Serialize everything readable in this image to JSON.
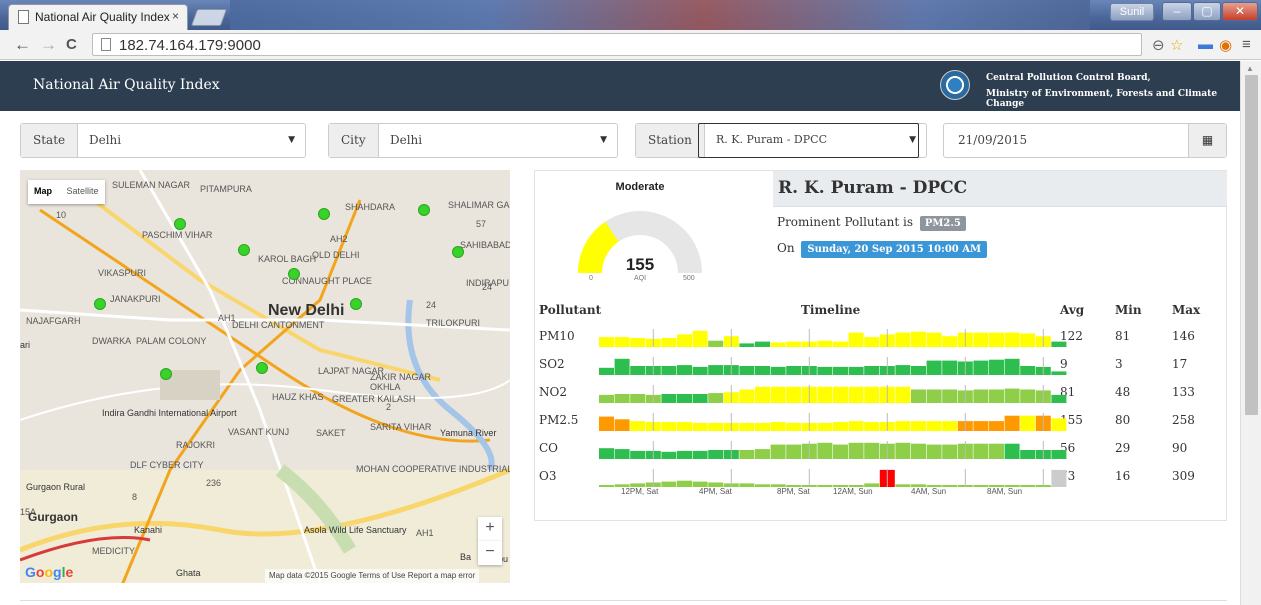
{
  "browser": {
    "tab_title": "National Air Quality Index",
    "tab_close": "×",
    "user": "Sunil",
    "url": "182.74.164.179:9000"
  },
  "header": {
    "title": "National Air Quality Index",
    "org_line1": "Central Pollution Control Board,",
    "org_line2": "Ministry of Environment, Forests and Climate Change"
  },
  "filters": {
    "state_label": "State",
    "state_value": "Delhi",
    "city_label": "City",
    "city_value": "Delhi",
    "station_label": "Station",
    "station_value": "R. K. Puram - DPCC",
    "date_value": "21/09/2015"
  },
  "map": {
    "type_map": "Map",
    "type_satellite": "Satellite",
    "labels": [
      {
        "text": "SULEMAN NAGAR",
        "cls": ""
      },
      {
        "text": "PITAMPURA",
        "cls": ""
      },
      {
        "text": "SHAHDARA",
        "cls": ""
      },
      {
        "text": "SHALIMAR GARDEN",
        "cls": ""
      },
      {
        "text": "PASCHIM VIHAR",
        "cls": ""
      },
      {
        "text": "SAHIBABAD",
        "cls": ""
      },
      {
        "text": "KAROL BAGH",
        "cls": ""
      },
      {
        "text": "OLD DELHI",
        "cls": ""
      },
      {
        "text": "VIKASPURI",
        "cls": ""
      },
      {
        "text": "CONNAUGHT PLACE",
        "cls": ""
      },
      {
        "text": "INDIRAPU",
        "cls": ""
      },
      {
        "text": "JANAKPURI",
        "cls": ""
      },
      {
        "text": "New Delhi",
        "cls": "big"
      },
      {
        "text": "NAJAFGARH",
        "cls": ""
      },
      {
        "text": "DELHI CANTONMENT",
        "cls": ""
      },
      {
        "text": "TRILOKPURI",
        "cls": ""
      },
      {
        "text": "DWARKA",
        "cls": ""
      },
      {
        "text": "PALAM COLONY",
        "cls": ""
      },
      {
        "text": "LAJPAT NAGAR",
        "cls": ""
      },
      {
        "text": "ZAKIR NAGAR",
        "cls": ""
      },
      {
        "text": "OKHLA",
        "cls": ""
      },
      {
        "text": "Indira Gandhi International Airport",
        "cls": "nrm"
      },
      {
        "text": "HAUZ KHAS",
        "cls": ""
      },
      {
        "text": "GREATER KAILASH",
        "cls": ""
      },
      {
        "text": "VASANT KUNJ",
        "cls": ""
      },
      {
        "text": "SAKET",
        "cls": ""
      },
      {
        "text": "SARITA VIHAR",
        "cls": ""
      },
      {
        "text": "Yamuna River",
        "cls": "nrm"
      },
      {
        "text": "RAJOKRI",
        "cls": ""
      },
      {
        "text": "DLF CYBER CITY",
        "cls": ""
      },
      {
        "text": "MOHAN COOPERATIVE INDUSTRIAL ESTATE",
        "cls": ""
      },
      {
        "text": "Gurgaon Rural",
        "cls": "nrm"
      },
      {
        "text": "Gurgaon",
        "cls": "mid"
      },
      {
        "text": "Kanahi",
        "cls": "nrm"
      },
      {
        "text": "MEDICITY",
        "cls": ""
      },
      {
        "text": "Asola Wild Life Sanctuary",
        "cls": "nrm"
      },
      {
        "text": "Ghata",
        "cls": "nrm"
      },
      {
        "text": "Ba",
        "cls": "nrm"
      },
      {
        "text": "pu",
        "cls": "nrm"
      },
      {
        "text": "ari",
        "cls": "nrm"
      },
      {
        "text": "AH2",
        "cls": ""
      },
      {
        "text": "AH1",
        "cls": ""
      },
      {
        "text": "AH1",
        "cls": ""
      },
      {
        "text": "57",
        "cls": ""
      },
      {
        "text": "24",
        "cls": ""
      },
      {
        "text": "24",
        "cls": ""
      },
      {
        "text": "10",
        "cls": ""
      },
      {
        "text": "10",
        "cls": ""
      },
      {
        "text": "8",
        "cls": ""
      },
      {
        "text": "236",
        "cls": ""
      },
      {
        "text": "15A",
        "cls": ""
      },
      {
        "text": "2",
        "cls": ""
      }
    ],
    "zoom_in": "+",
    "zoom_out": "−",
    "google": "Google",
    "attribution": "Map data ©2015 Google   Terms of Use   Report a map error"
  },
  "aqi": {
    "category": "Moderate",
    "value": 155,
    "value_text": "155",
    "unit": "AQI",
    "min": "0",
    "max": "500",
    "max_value": 500,
    "gauge_color": "#ffff00",
    "station_name": "R. K. Puram - DPCC",
    "prominent_text": "Prominent Pollutant is",
    "prominent": "PM2.5",
    "on_text": "On",
    "timestamp": "Sunday, 20 Sep 2015 10:00 AM"
  },
  "table": {
    "col_pollutant": "Pollutant",
    "col_timeline": "Timeline",
    "col_avg": "Avg",
    "col_min": "Min",
    "col_max": "Max",
    "rows": [
      {
        "name": "PM10",
        "avg": "122",
        "min": "81",
        "max": "146"
      },
      {
        "name": "SO2",
        "avg": "9",
        "min": "3",
        "max": "17"
      },
      {
        "name": "NO2",
        "avg": "81",
        "min": "48",
        "max": "133"
      },
      {
        "name": "PM2.5",
        "avg": "155",
        "min": "80",
        "max": "258"
      },
      {
        "name": "CO",
        "avg": "56",
        "min": "29",
        "max": "90"
      },
      {
        "name": "O3",
        "avg": "73",
        "min": "16",
        "max": "309"
      }
    ]
  },
  "chart_data": {
    "type": "bar",
    "x": [
      "12PM, Sat",
      "4PM, Sat",
      "8PM, Sat",
      "12AM, Sun",
      "4AM, Sun",
      "8AM, Sun"
    ],
    "colors": {
      "G": "#2ebd4f",
      "L": "#8fce48",
      "Y": "#ffff00",
      "O": "#ff9900",
      "R": "#ff0000",
      "N": "#cccccc"
    },
    "series": [
      {
        "name": "PM10",
        "heights": [
          0.55,
          0.55,
          0.5,
          0.45,
          0.5,
          0.7,
          0.9,
          0.35,
          0.6,
          0.2,
          0.3,
          0.25,
          0.3,
          0.3,
          0.35,
          0.3,
          0.8,
          0.55,
          0.7,
          0.8,
          0.85,
          0.8,
          0.6,
          0.8,
          0.8,
          0.8,
          0.8,
          0.75,
          0.6,
          0.3
        ],
        "colors": "YYYYYYYLYGGYYYYYYYYYYYYYYYYYYG"
      },
      {
        "name": "SO2",
        "heights": [
          0.4,
          0.9,
          0.5,
          0.5,
          0.5,
          0.55,
          0.45,
          0.55,
          0.55,
          0.5,
          0.5,
          0.45,
          0.5,
          0.5,
          0.45,
          0.45,
          0.45,
          0.5,
          0.5,
          0.55,
          0.5,
          0.8,
          0.8,
          0.75,
          0.8,
          0.85,
          0.9,
          0.5,
          0.45,
          0.2
        ],
        "colors": "GGGGGGGGGGGGGGGGGGGGGGGGGGGGGG"
      },
      {
        "name": "NO2",
        "heights": [
          0.45,
          0.5,
          0.5,
          0.45,
          0.5,
          0.5,
          0.5,
          0.55,
          0.6,
          0.75,
          0.9,
          0.9,
          0.9,
          0.9,
          0.9,
          0.9,
          0.9,
          0.9,
          0.9,
          0.9,
          0.75,
          0.75,
          0.75,
          0.7,
          0.75,
          0.75,
          0.8,
          0.75,
          0.7,
          0.45
        ],
        "colors": "LLLLGGGLYYYYYYYYYYYYLLLLLLLLLG"
      },
      {
        "name": "PM2.5",
        "heights": [
          0.8,
          0.65,
          0.55,
          0.5,
          0.5,
          0.5,
          0.45,
          0.45,
          0.45,
          0.45,
          0.45,
          0.5,
          0.45,
          0.45,
          0.45,
          0.5,
          0.55,
          0.5,
          0.5,
          0.55,
          0.55,
          0.55,
          0.55,
          0.55,
          0.55,
          0.55,
          0.85,
          0.85,
          0.85,
          0.7
        ],
        "colors": "OOYYYYYYYYYYYYYYYYYYYYYOOOOYOY"
      },
      {
        "name": "CO",
        "heights": [
          0.6,
          0.55,
          0.45,
          0.45,
          0.4,
          0.45,
          0.45,
          0.5,
          0.5,
          0.5,
          0.55,
          0.8,
          0.8,
          0.85,
          0.9,
          0.8,
          0.9,
          0.9,
          0.85,
          0.9,
          0.85,
          0.8,
          0.8,
          0.85,
          0.85,
          0.85,
          0.85,
          0.5,
          0.5,
          0.5
        ],
        "colors": "GGGGGGGGGLLLLLLLLLLLLLLLLLGGGG"
      },
      {
        "name": "O3",
        "heights": [
          0.1,
          0.15,
          0.2,
          0.25,
          0.3,
          0.35,
          0.3,
          0.25,
          0.2,
          0.2,
          0.15,
          0.15,
          0.1,
          0.1,
          0.1,
          0.1,
          0.1,
          0.2,
          0.95,
          0.15,
          0.15,
          0.1,
          0.1,
          0.1,
          0.1,
          0.1,
          0.1,
          0.1,
          0.1,
          0.95
        ],
        "colors": "LLLLLLLLLLLLLLLLLLRLLLLLLLLLLN"
      }
    ]
  }
}
